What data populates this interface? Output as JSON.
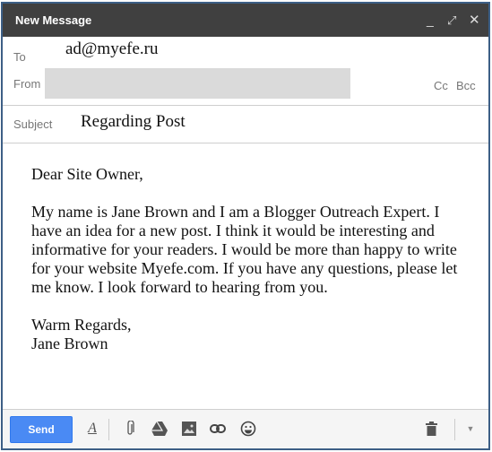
{
  "window": {
    "title": "New Message",
    "minimize_icon": "minimize-icon",
    "expand_icon": "expand-icon",
    "close_icon": "close-icon"
  },
  "fields": {
    "to_label": "To",
    "to_value": "ad@myefe.ru",
    "from_label": "From",
    "cc_label": "Cc",
    "bcc_label": "Bcc",
    "subject_label": "Subject",
    "subject_value": "Regarding Post"
  },
  "body": {
    "paragraphs": [
      "Dear Site Owner,",
      "My name is Jane Brown and I am a Blogger Outreach Expert. I have an idea for a new post. I think it would be interesting and informative for your readers. I would be more than happy to write for your website Myefe.com. If you have any questions, please let me know. I look forward to hearing from you.",
      "Warm Regards,\nJane Brown"
    ]
  },
  "toolbar": {
    "send_label": "Send",
    "send_color": "#4a8af4"
  }
}
